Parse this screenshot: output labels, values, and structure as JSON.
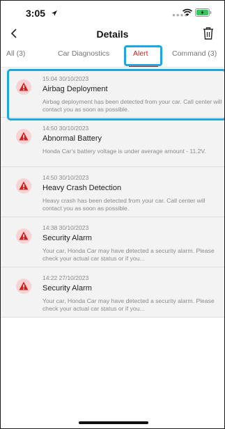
{
  "status_bar": {
    "time": "3:05"
  },
  "header": {
    "title": "Details"
  },
  "tabs": [
    {
      "label": "All (3)"
    },
    {
      "label": "Car Diagnostics"
    },
    {
      "label": "Alert"
    },
    {
      "label": "Command (3)"
    }
  ],
  "selected_tab": "Alert",
  "alerts": [
    {
      "time": "15:04 30/10/2023",
      "title": "Airbag Deployment",
      "body": "Airbag deployment has been detected from your car. Call center will contact you as soon as possible."
    },
    {
      "time": "14:50 30/10/2023",
      "title": "Abnormal Battery",
      "body": "Honda Car's battery voltage is under average amount - 11.2V."
    },
    {
      "time": "14:50 30/10/2023",
      "title": "Heavy Crash Detection",
      "body": "Heavy crash has been detected from your car. Call center will contact you as soon as possible."
    },
    {
      "time": "14:38 30/10/2023",
      "title": "Security Alarm",
      "body": "Your car, Honda Car may have detected a security alarm. Please check your actual car status or if you..."
    },
    {
      "time": "14:22 27/10/2023",
      "title": "Security Alarm",
      "body": "Your car, Honda Car may have detected a security alarm. Please check your actual car status or if you..."
    }
  ],
  "colors": {
    "accent": "#e01a1a",
    "highlight": "#1ba7e0",
    "list_bg": "#f3f3f3"
  },
  "icons": {
    "back": "chevron-left-icon",
    "delete": "trash-icon",
    "alert": "warning-icon"
  }
}
